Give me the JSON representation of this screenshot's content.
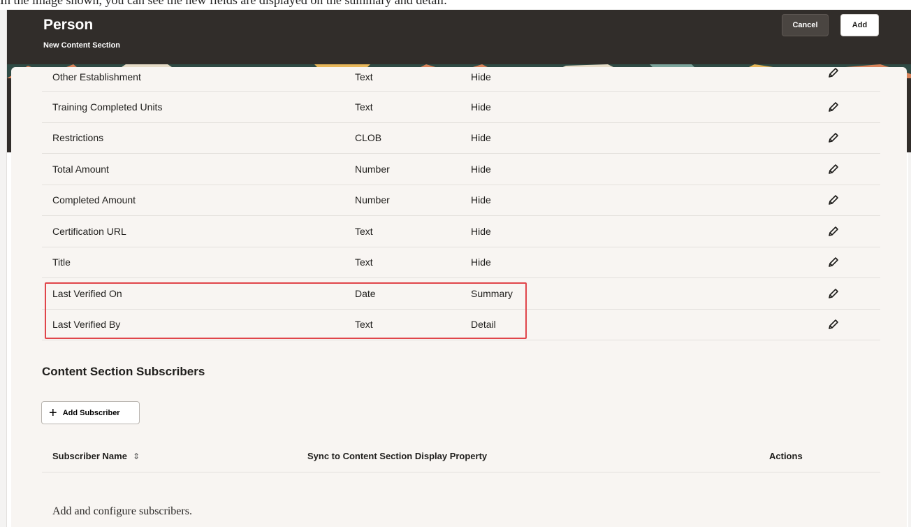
{
  "caption": "In the image shown, you can see the new fields are displayed on the summary and detail.",
  "header": {
    "title": "Person",
    "subtitle": "New Content Section",
    "cancel_label": "Cancel",
    "add_label": "Add"
  },
  "fields": [
    {
      "name": "Other Establishment",
      "type": "Text",
      "display": "Hide"
    },
    {
      "name": "Training Completed Units",
      "type": "Text",
      "display": "Hide"
    },
    {
      "name": "Restrictions",
      "type": "CLOB",
      "display": "Hide"
    },
    {
      "name": "Total Amount",
      "type": "Number",
      "display": "Hide"
    },
    {
      "name": "Completed Amount",
      "type": "Number",
      "display": "Hide"
    },
    {
      "name": "Certification URL",
      "type": "Text",
      "display": "Hide"
    },
    {
      "name": "Title",
      "type": "Text",
      "display": "Hide"
    },
    {
      "name": "Last Verified On",
      "type": "Date",
      "display": "Summary"
    },
    {
      "name": "Last Verified By",
      "type": "Text",
      "display": "Detail"
    }
  ],
  "icons": {
    "edit": "pencil-icon",
    "add": "plus-icon",
    "sort": "sort-icon"
  },
  "highlight_color": "#e0454a",
  "subscribers": {
    "section_title": "Content Section Subscribers",
    "add_button_label": "Add Subscriber",
    "columns": {
      "name": "Subscriber Name",
      "sync": "Sync to Content Section Display Property",
      "actions": "Actions"
    },
    "empty_message": "Add and configure subscribers."
  }
}
